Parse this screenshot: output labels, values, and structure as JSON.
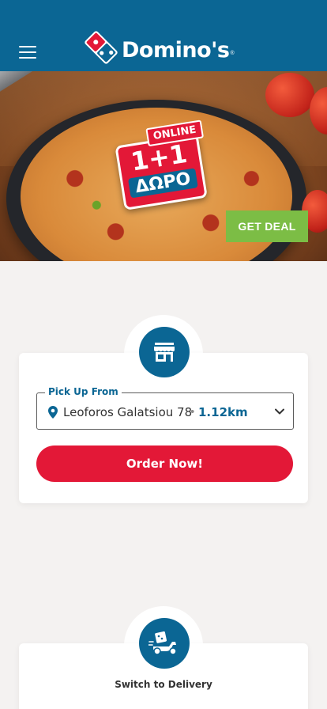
{
  "header": {
    "brand": "Domino's",
    "reg_mark": "®",
    "menu_icon": "hamburger-menu-icon",
    "logo_icon": "dominos-domino-logo-icon",
    "background_color": "#0b6694"
  },
  "hero": {
    "badge_online": "ONLINE",
    "badge_offer": "1+1",
    "badge_sub": "ΔΩΡΟ",
    "cta_label": "GET DEAL",
    "cta_color": "#7cbd45"
  },
  "pickup": {
    "icon": "store-icon",
    "label": "Pick Up From",
    "store_name": "Leoforos Galatsiou 78",
    "separator": "•",
    "distance": "1.12km",
    "pin_icon": "location-pin-icon",
    "dropdown_icon": "chevron-down-icon",
    "order_button": "Order Now!",
    "order_button_color": "#e31837"
  },
  "delivery": {
    "icon": "delivery-scooter-icon",
    "switch_label": "Switch to Delivery"
  }
}
